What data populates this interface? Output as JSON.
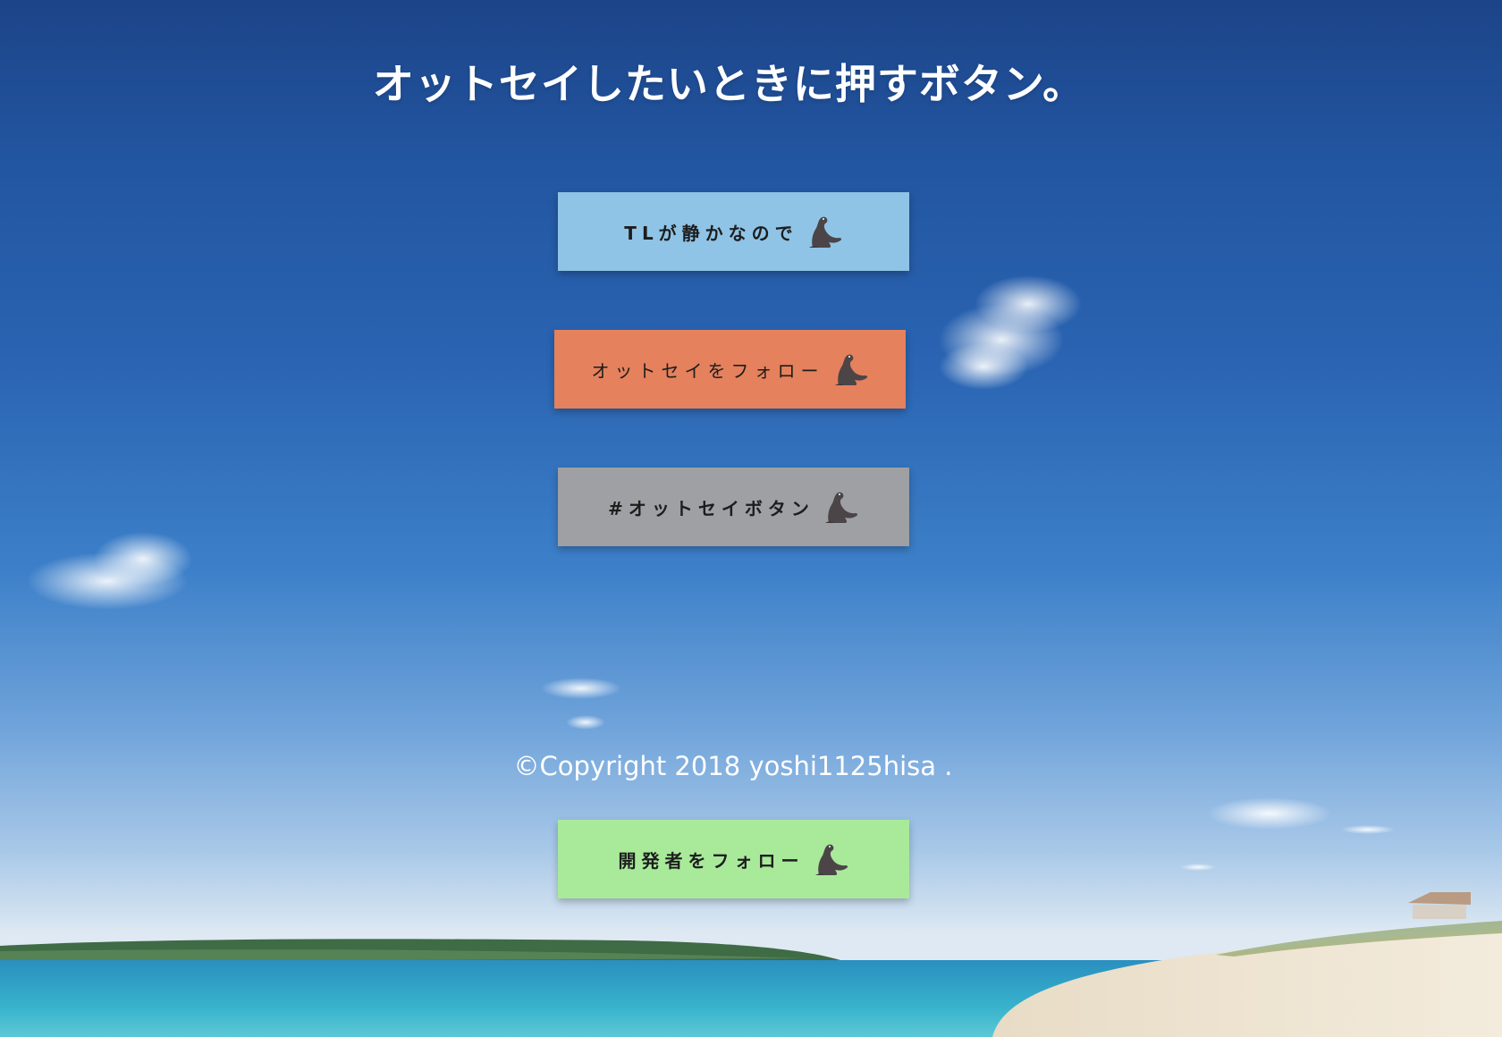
{
  "header": {
    "title": "オットセイしたいときに押すボタン。"
  },
  "buttons": [
    {
      "label": "TLが静かなので",
      "background": "#8fc4e6",
      "icon": "seal-icon"
    },
    {
      "label": "オットセイをフォロー",
      "background": "#e5815c",
      "icon": "seal-icon"
    },
    {
      "label": "#オットセイボタン",
      "background": "#9ea0a3",
      "icon": "seal-icon"
    }
  ],
  "footer": {
    "copyright": "©Copyright 2018 yoshi1125hisa .",
    "developer_button": {
      "label": "開発者をフォロー",
      "background": "#a8ea9a",
      "icon": "seal-icon"
    }
  },
  "colors": {
    "sky_top": "#1c4488",
    "sky_bottom": "#dfe9f3",
    "sea": "#2fa3c4",
    "sand": "#efe6d6"
  }
}
